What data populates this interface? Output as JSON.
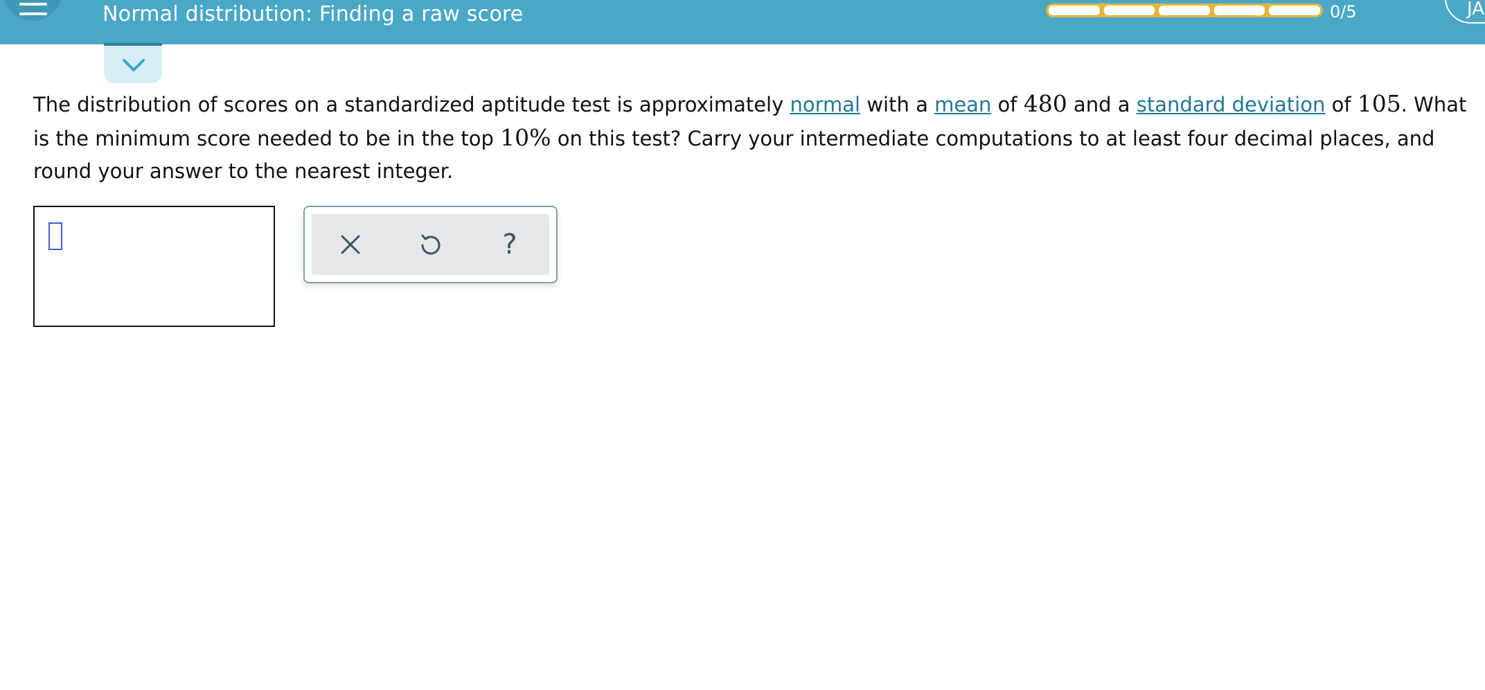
{
  "header": {
    "title": "Normal distribution: Finding a raw score",
    "progress_count": "0/5",
    "progress_segments": 5,
    "progress_fraction": 0,
    "avatar_initials": "JA",
    "colors": {
      "header_bg": "#4aa8c6",
      "progress_border": "#e5b638"
    },
    "icons": {
      "menu": "hamburger-menu-icon",
      "collapse": "chevron-down-icon"
    }
  },
  "question": {
    "text_1": "The distribution of scores on a standardized aptitude test is approximately ",
    "link_normal": "normal",
    "text_2": " with a ",
    "link_mean": "mean",
    "text_3": " of ",
    "mean_value": "480",
    "text_4": " and a ",
    "link_sd": "standard deviation",
    "text_5": " of ",
    "sd_value": "105",
    "text_6": ". What is the minimum score needed to be in the top ",
    "percent_value": "10%",
    "text_7": " on this test? Carry your intermediate computations to at least four decimal places, and round your answer to the nearest integer."
  },
  "answer": {
    "value": ""
  },
  "toolbox": {
    "icons": {
      "clear": "close-icon",
      "undo": "undo-icon",
      "help": "help-icon"
    },
    "help_glyph": "?"
  }
}
